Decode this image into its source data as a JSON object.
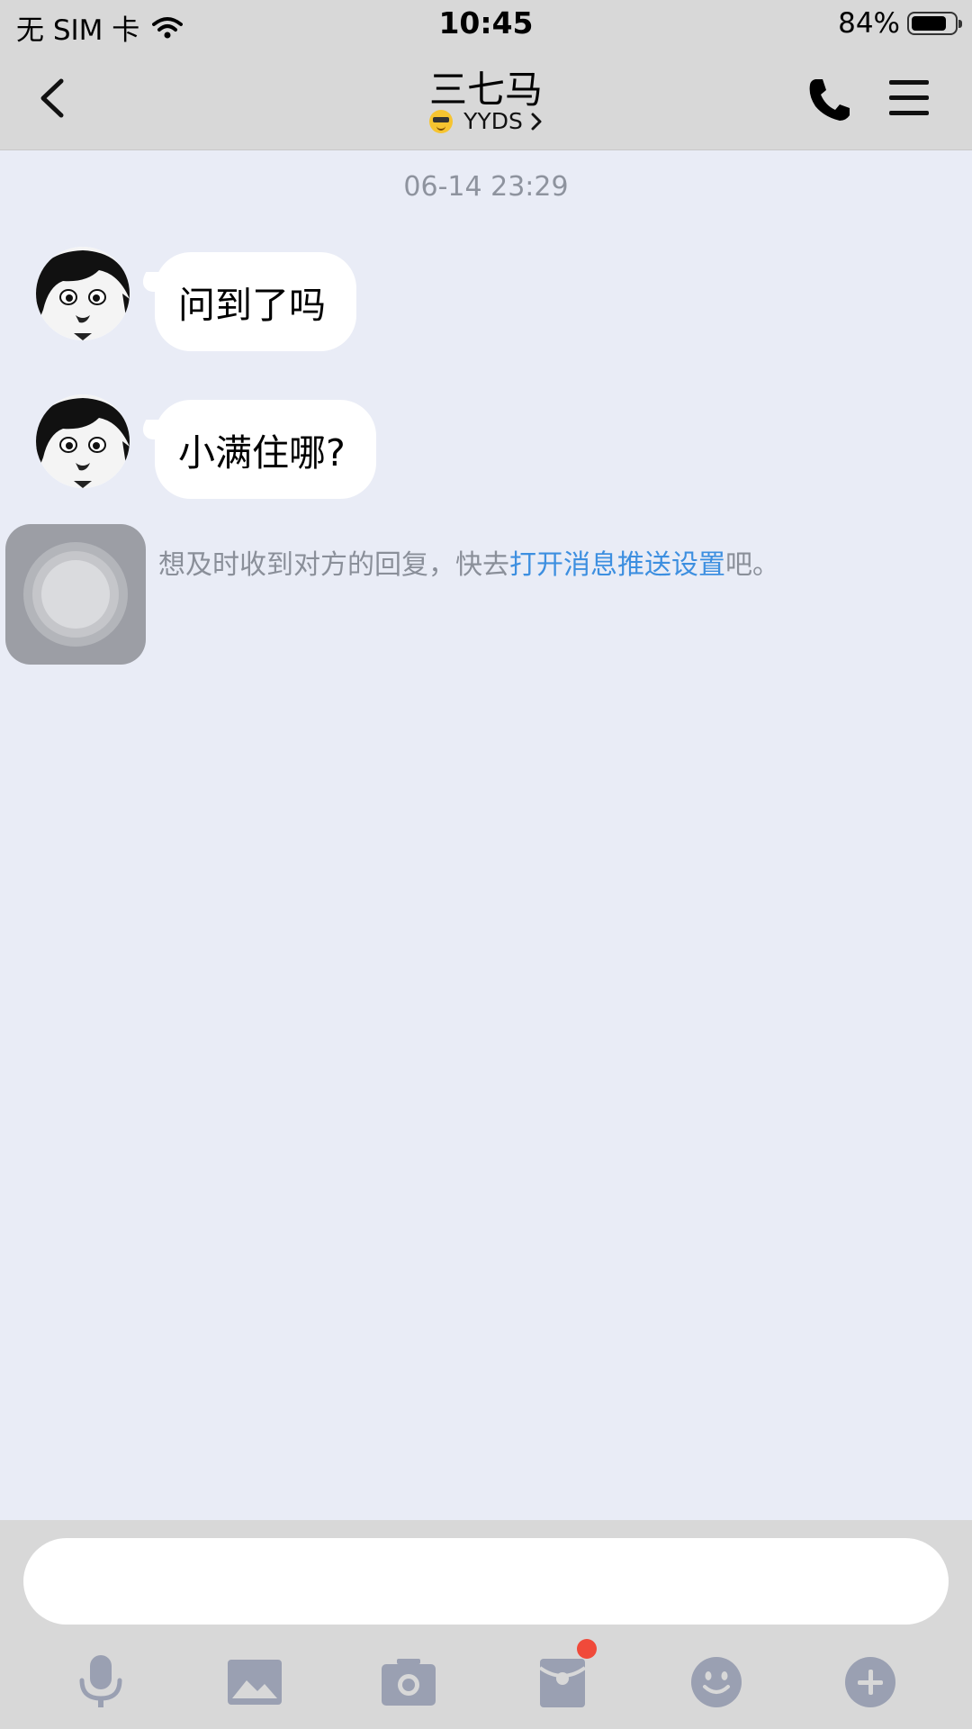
{
  "status_bar": {
    "carrier": "无 SIM 卡",
    "time": "10:45",
    "battery_percent": "84%",
    "battery_level": 0.84
  },
  "header": {
    "title": "三七马",
    "status_emoji": "sunglasses-emoji",
    "status_text": "YYDS"
  },
  "conversation": {
    "timestamp": "06-14 23:29",
    "messages": [
      {
        "text": "问到了吗"
      },
      {
        "text": "小满住哪?"
      }
    ],
    "notice": {
      "prefix": "想及时收到对方的回复，快去",
      "link": "打开消息推送设置",
      "suffix": "吧。"
    }
  },
  "input": {
    "value": "",
    "placeholder": ""
  },
  "toolbar_icons": [
    "microphone-icon",
    "image-icon",
    "camera-icon",
    "red-packet-icon",
    "emoji-icon",
    "plus-icon"
  ],
  "colors": {
    "chat_background": "#e9ecf6",
    "bar_background": "#d8d8d8",
    "link": "#3d8fe0",
    "icon": "#9aa0b2",
    "badge": "#f04a3a"
  }
}
